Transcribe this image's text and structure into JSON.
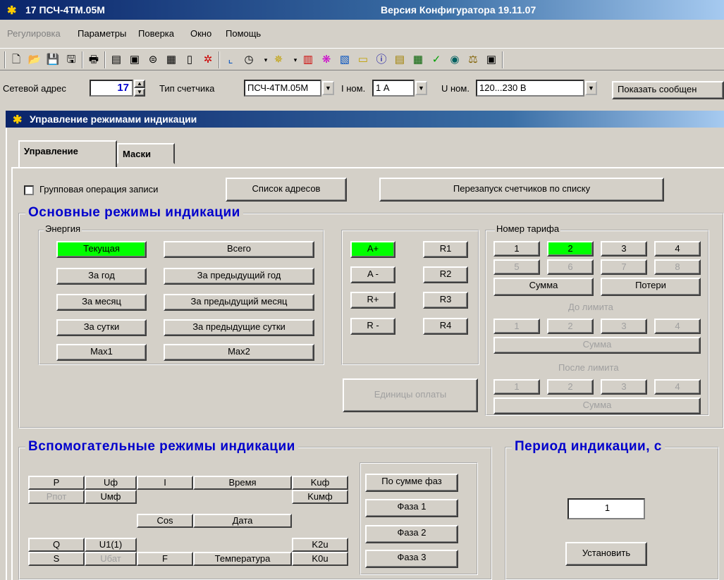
{
  "window": {
    "title": "17 ПСЧ-4ТМ.05М",
    "version": "Версия Конфигуратора 19.11.07"
  },
  "menu": [
    {
      "label": "Регулировка",
      "disabled": true
    },
    {
      "label": "Параметры",
      "disabled": false
    },
    {
      "label": "Поверка",
      "disabled": false
    },
    {
      "label": "Окно",
      "disabled": false
    },
    {
      "label": "Помощь",
      "disabled": false
    }
  ],
  "addrbar": {
    "net_label": "Сетевой адрес",
    "net_value": "17",
    "meter_label": "Тип счетчика",
    "meter_value": "ПСЧ-4ТМ.05М",
    "inom_label": "I ном.",
    "inom_value": "1 А",
    "unom_label": "U ном.",
    "unom_value": "120...230 В",
    "show_btn": "Показать сообщен"
  },
  "child_window": {
    "title": "Управление режимами индикации"
  },
  "tabs": {
    "control": "Управление",
    "masks": "Маски"
  },
  "top": {
    "group_op_label": "Групповая операция записи",
    "address_list_btn": "Список адресов",
    "restart_btn": "Перезапуск счетчиков по списку"
  },
  "main_modes": {
    "title": "Основные режимы индикации",
    "energy_title": "Энергия",
    "energy": {
      "current": "Текущая",
      "total": "Всего",
      "year": "За год",
      "prev_year": "За предыдущий год",
      "month": "За месяц",
      "prev_month": "За предыдущий месяц",
      "day": "За сутки",
      "prev_day": "За предыдущие сутки",
      "max1": "Max1",
      "max2": "Max2"
    },
    "channels": {
      "ap": "A+",
      "am": "A -",
      "rp": "R+",
      "rm": "R -",
      "r1": "R1",
      "r2": "R2",
      "r3": "R3",
      "r4": "R4"
    },
    "payment_units": "Единицы оплаты",
    "tariff_title": "Номер тарифа",
    "tariff": [
      "1",
      "2",
      "3",
      "4",
      "5",
      "6",
      "7",
      "8"
    ],
    "tariff_sum": "Сумма",
    "losses": "Потери",
    "before_limit": "До лимита",
    "after_limit": "После лимита",
    "limit_nums": [
      "1",
      "2",
      "3",
      "4"
    ],
    "limit_sum": "Сумма"
  },
  "aux_modes": {
    "title": "Вспомогательные режимы индикации",
    "cells": {
      "p": "P",
      "uf": "Uф",
      "i": "I",
      "time": "Время",
      "kuf": "Kuф",
      "ppot": "Pпот",
      "umf": "Uмф",
      "kumf": "Kuмф",
      "cos": "Cos",
      "date": "Дата",
      "q": "Q",
      "u11": "U1(1)",
      "k2u": "K2u",
      "s": "S",
      "ubat": "Uбат",
      "f": "F",
      "temp": "Температура",
      "k0u": "K0u"
    },
    "phase_sum": "По сумме фаз",
    "phase1": "Фаза 1",
    "phase2": "Фаза 2",
    "phase3": "Фаза 3"
  },
  "period": {
    "title": "Период индикации, с",
    "value": "1",
    "set_btn": "Установить"
  },
  "colors": {
    "accent": "#00ff00",
    "title_blue": "#0000cc"
  }
}
